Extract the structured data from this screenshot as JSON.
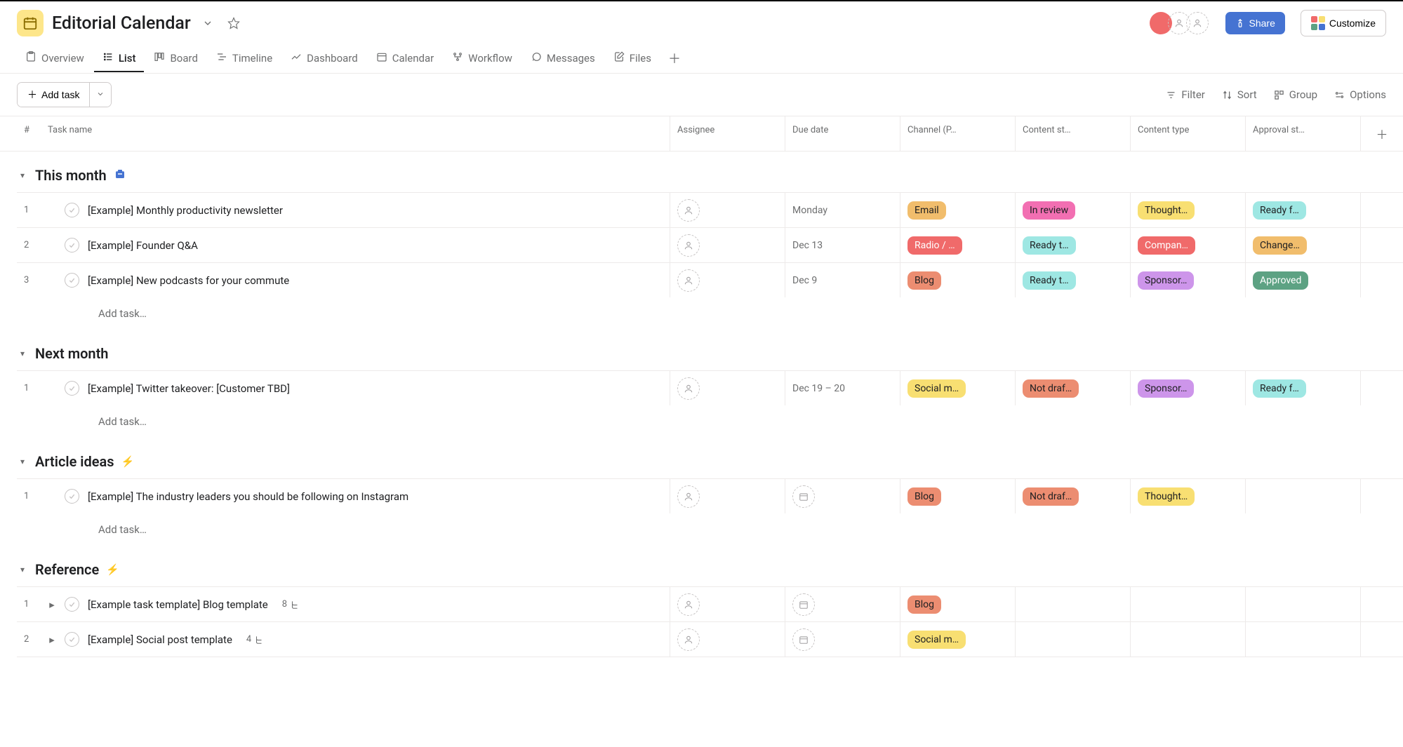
{
  "header": {
    "title": "Editorial Calendar",
    "share_label": "Share",
    "customize_label": "Customize"
  },
  "tabs": [
    {
      "id": "overview",
      "label": "Overview"
    },
    {
      "id": "list",
      "label": "List"
    },
    {
      "id": "board",
      "label": "Board"
    },
    {
      "id": "timeline",
      "label": "Timeline"
    },
    {
      "id": "dashboard",
      "label": "Dashboard"
    },
    {
      "id": "calendar",
      "label": "Calendar"
    },
    {
      "id": "workflow",
      "label": "Workflow"
    },
    {
      "id": "messages",
      "label": "Messages"
    },
    {
      "id": "files",
      "label": "Files"
    }
  ],
  "active_tab": "list",
  "toolbar": {
    "addtask_label": "Add task",
    "filter_label": "Filter",
    "sort_label": "Sort",
    "group_label": "Group",
    "options_label": "Options"
  },
  "columns": {
    "num": "#",
    "name": "Task name",
    "assignee": "Assignee",
    "due": "Due date",
    "channel": "Channel (P…",
    "cstage": "Content st…",
    "ctype": "Content type",
    "approval": "Approval st…"
  },
  "add_task_placeholder": "Add task…",
  "sections": [
    {
      "title": "This month",
      "icon": "brief",
      "tasks": [
        {
          "num": "1",
          "name": "[Example] Monthly productivity newsletter",
          "due": "Monday",
          "channel": {
            "text": "Email",
            "cls": "c-email"
          },
          "cstage": {
            "text": "In review",
            "cls": "c-inrev"
          },
          "ctype": {
            "text": "Thought…",
            "cls": "c-thought"
          },
          "approval": {
            "text": "Ready f…",
            "cls": "c-readyf"
          }
        },
        {
          "num": "2",
          "name": "[Example] Founder Q&A",
          "due": "Dec 13",
          "channel": {
            "text": "Radio / …",
            "cls": "c-radio"
          },
          "cstage": {
            "text": "Ready t…",
            "cls": "c-ready"
          },
          "ctype": {
            "text": "Compan…",
            "cls": "c-company"
          },
          "approval": {
            "text": "Change…",
            "cls": "c-changes"
          }
        },
        {
          "num": "3",
          "name": "[Example] New podcasts for your commute",
          "due": "Dec 9",
          "channel": {
            "text": "Blog",
            "cls": "c-blog"
          },
          "cstage": {
            "text": "Ready t…",
            "cls": "c-ready"
          },
          "ctype": {
            "text": "Sponsor…",
            "cls": "c-sponsor"
          },
          "approval": {
            "text": "Approved",
            "cls": "c-approved"
          }
        }
      ]
    },
    {
      "title": "Next month",
      "icon": null,
      "tasks": [
        {
          "num": "1",
          "name": "[Example] Twitter takeover: [Customer TBD]",
          "due": "Dec 19 – 20",
          "channel": {
            "text": "Social m…",
            "cls": "c-social"
          },
          "cstage": {
            "text": "Not draf…",
            "cls": "c-ndraft"
          },
          "ctype": {
            "text": "Sponsor…",
            "cls": "c-sponsor"
          },
          "approval": {
            "text": "Ready f…",
            "cls": "c-readyf"
          }
        }
      ]
    },
    {
      "title": "Article ideas",
      "icon": "bolt",
      "tasks": [
        {
          "num": "1",
          "name": "[Example] The industry leaders you should be following on Instagram",
          "due": "",
          "due_icon": true,
          "channel": {
            "text": "Blog",
            "cls": "c-blog"
          },
          "cstage": {
            "text": "Not draf…",
            "cls": "c-ndraft"
          },
          "ctype": {
            "text": "Thought…",
            "cls": "c-thought"
          },
          "approval": null
        }
      ]
    },
    {
      "title": "Reference",
      "icon": "bolt",
      "no_add_row": true,
      "tasks": [
        {
          "num": "1",
          "name": "[Example task template] Blog template",
          "expand": true,
          "subtasks": "8",
          "due": "",
          "due_icon": true,
          "channel": {
            "text": "Blog",
            "cls": "c-blog"
          },
          "cstage": null,
          "ctype": null,
          "approval": null
        },
        {
          "num": "2",
          "name": "[Example] Social post template",
          "expand": true,
          "subtasks": "4",
          "due": "",
          "due_icon": true,
          "channel": {
            "text": "Social m…",
            "cls": "c-social"
          },
          "cstage": null,
          "ctype": null,
          "approval": null
        }
      ]
    }
  ]
}
